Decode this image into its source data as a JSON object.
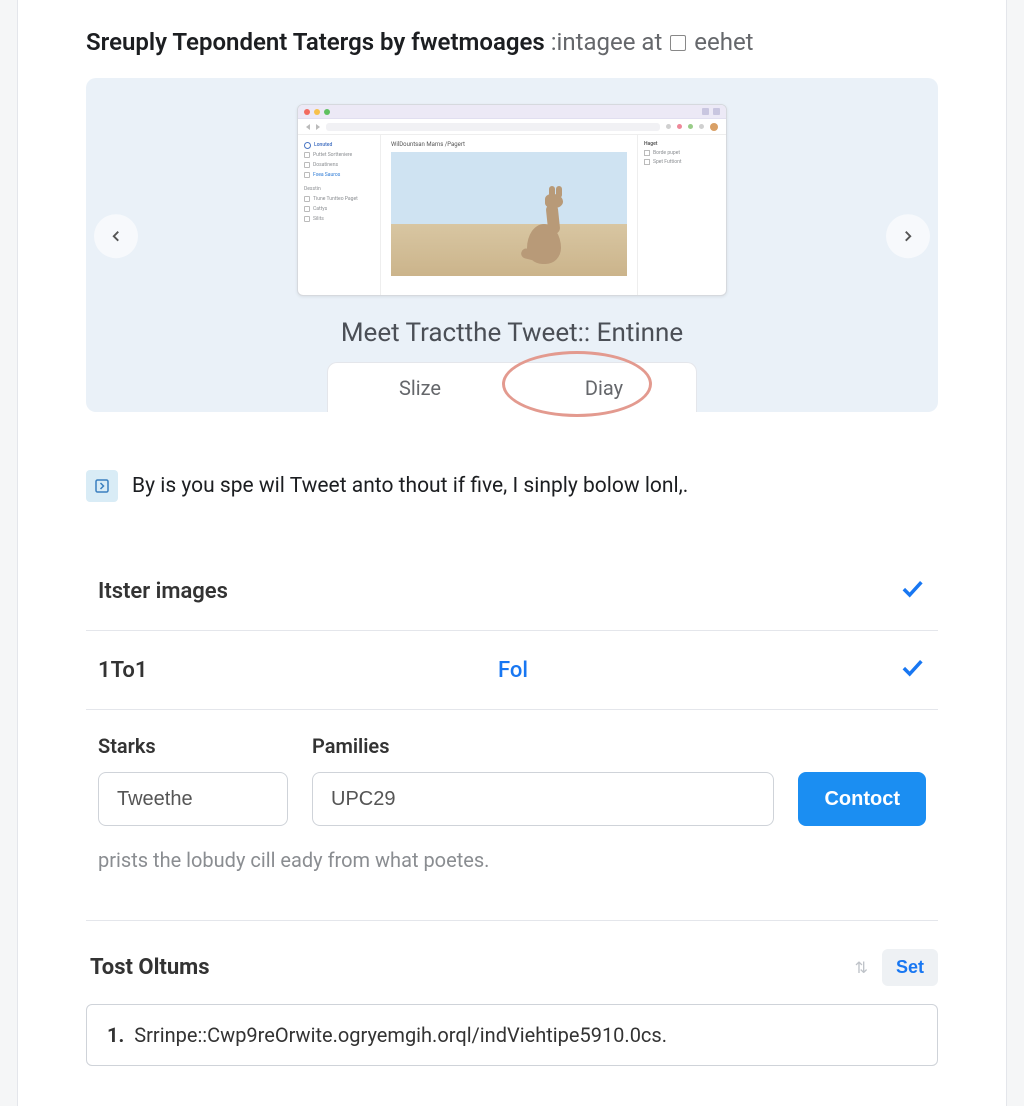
{
  "header": {
    "title_strong": "Sreuply Tepondent Tatergs by fwetmoages",
    "title_light": " :intagee at",
    "title_trail": "eehet"
  },
  "hero": {
    "caption": "Meet Tractthe Tweet:: Entinne",
    "tabs": {
      "a": "Slize",
      "b": "Diay"
    },
    "mock": {
      "side_header": "Lonuted",
      "side_items": [
        "Puttet Sortteniere",
        "Dosatinens",
        "Fxea Sauros"
      ],
      "side_group": "Desstin",
      "side_group_items": [
        "Tiune Tuntteo Paget",
        "Cattys",
        "Silits"
      ],
      "main_caption": "WilDountsan Marns /Pagert",
      "right_header": "Haget",
      "right_items": [
        "Borde pupet",
        "Spet Futtiont"
      ]
    }
  },
  "info_line": "By is you spe wil Tweet anto thout if five, I sinply bolow lonl,.",
  "rows": {
    "r1": {
      "label": "Itster images"
    },
    "r2": {
      "label": "1To1",
      "link": "Fol"
    }
  },
  "form": {
    "starks_label": "Starks",
    "starks_value": "Tweethe",
    "pam_label": "Pamilies",
    "pam_value": "UPC29",
    "button": "Contoct",
    "hint": "prists the lobudy cill eady from what poetes."
  },
  "bottom": {
    "heading": "Tost Oltums",
    "set": "Set",
    "line_num": "1.",
    "line_text": "Srrinpe::Cwp9reOrwite.ogryemgih.orql/indViehtipe5910.0cs."
  }
}
